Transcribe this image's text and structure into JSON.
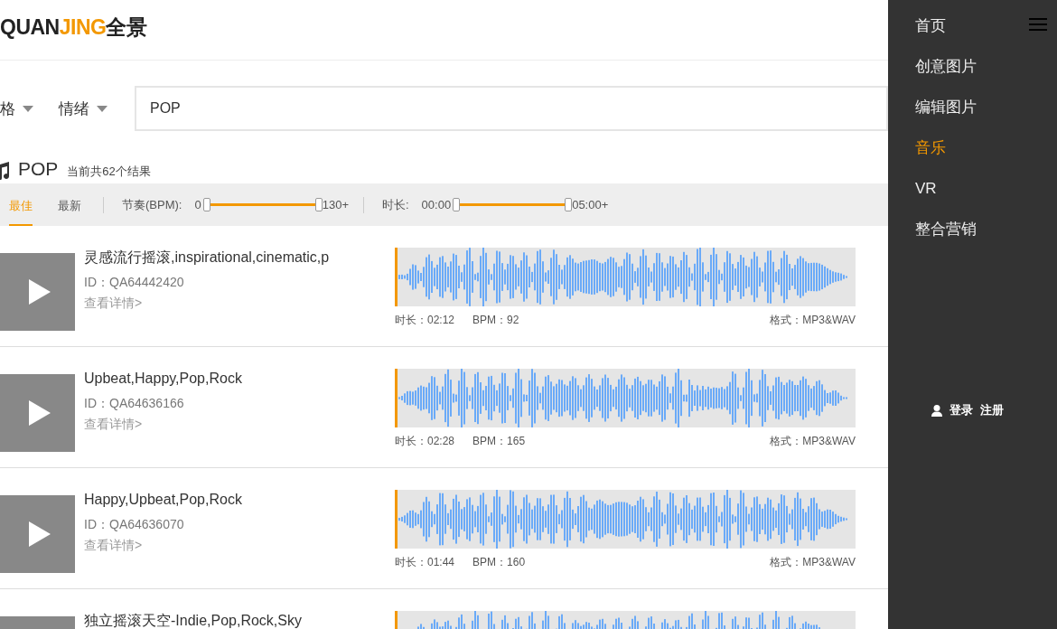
{
  "logo": {
    "part_1": "QUAN",
    "part_2": "JING",
    "part_3": "全景"
  },
  "filters": [
    {
      "label": "格"
    },
    {
      "label": "情绪"
    }
  ],
  "search": {
    "value": "POP"
  },
  "result": {
    "query": "POP",
    "count": "当前共62个结果"
  },
  "sort_tabs": [
    {
      "label": "最佳",
      "selected": true
    },
    {
      "label": "最新",
      "selected": false
    }
  ],
  "ranges": [
    {
      "label": "节奏(BPM):",
      "min": "0",
      "max": "130+",
      "level": 1
    },
    {
      "label": "时长:",
      "min": "00:00",
      "max": "05:00+",
      "level": 1
    }
  ],
  "tracks": [
    {
      "title": "灵感流行摇滚,inspirational,cinematic,p",
      "id": "ID：QA64442420",
      "detail": "查看详情>",
      "duration": "时长：02:12",
      "bpm": "BPM：92",
      "format": "格式：MP3&WAV"
    },
    {
      "title": "Upbeat,Happy,Pop,Rock",
      "id": "ID：QA64636166",
      "detail": "查看详情>",
      "duration": "时长：02:28",
      "bpm": "BPM：165",
      "format": "格式：MP3&WAV"
    },
    {
      "title": "Happy,Upbeat,Pop,Rock",
      "id": "ID：QA64636070",
      "detail": "查看详情>",
      "duration": "时长：01:44",
      "bpm": "BPM：160",
      "format": "格式：MP3&WAV"
    },
    {
      "title": "独立摇滚天空-Indie,Pop,Rock,Sky"
    }
  ],
  "sidebar": {
    "items": [
      {
        "label": "首页",
        "selected": false
      },
      {
        "label": "创意图片",
        "selected": false
      },
      {
        "label": "编辑图片",
        "selected": false
      },
      {
        "label": "音乐",
        "selected": true
      },
      {
        "label": "VR",
        "selected": false
      },
      {
        "label": "整合营销",
        "selected": false
      }
    ],
    "login": "登录",
    "register": "注册"
  }
}
